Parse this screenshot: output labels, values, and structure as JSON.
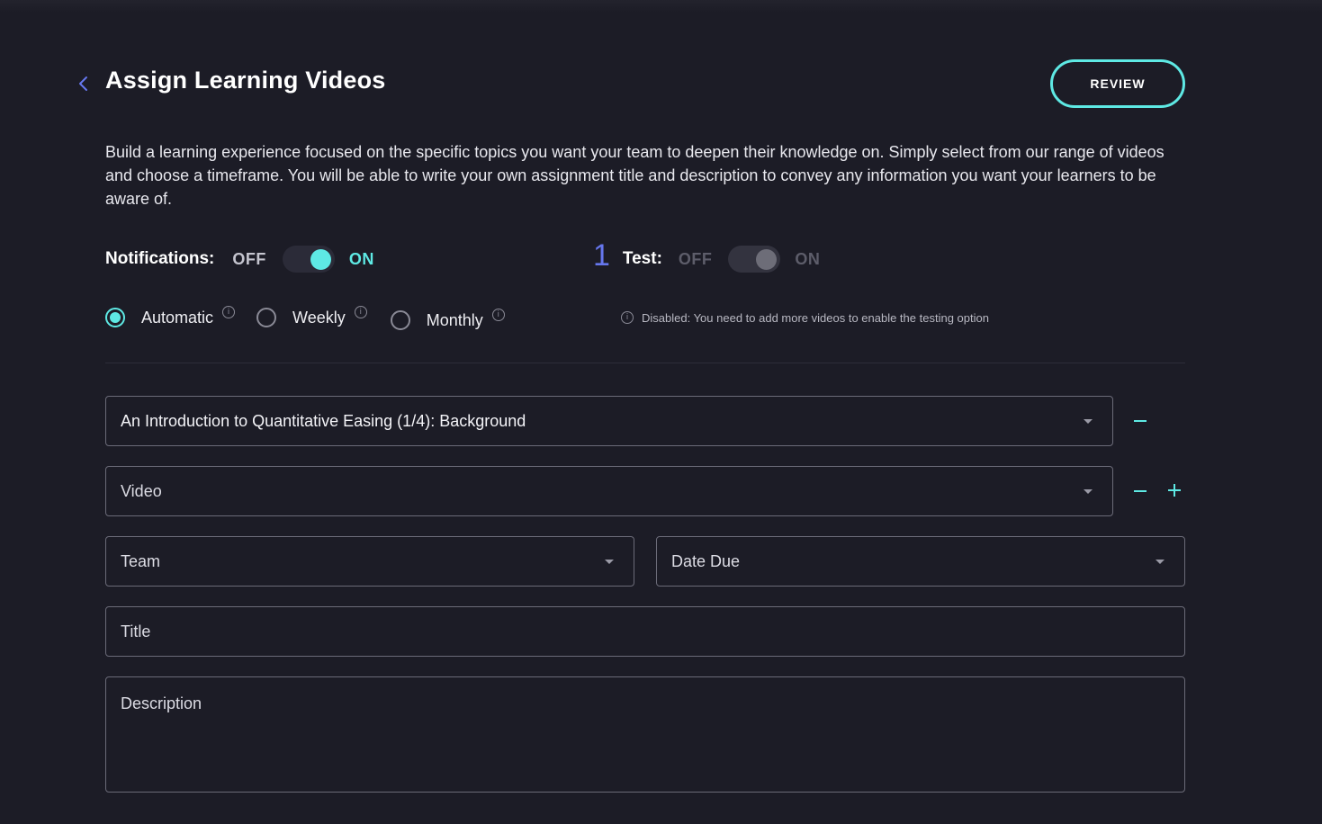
{
  "header": {
    "title": "Assign Learning Videos",
    "review_label": "REVIEW"
  },
  "intro": {
    "text": "Build a learning experience focused on the specific topics you want your team to deepen their knowledge on. Simply select from our range of videos and choose a timeframe. You will be able to write your own assignment title and description to convey any information you want your learners to be aware of."
  },
  "notifications": {
    "label": "Notifications:",
    "off_label": "OFF",
    "on_label": "ON",
    "state": "on"
  },
  "test": {
    "count": "1",
    "label": "Test:",
    "off_label": "OFF",
    "on_label": "ON",
    "state": "off",
    "disabled_note": "Disabled: You need to add more videos to enable the testing option"
  },
  "frequency": {
    "options": [
      {
        "label": "Automatic",
        "selected": true
      },
      {
        "label": "Weekly",
        "selected": false
      },
      {
        "label": "Monthly",
        "selected": false
      }
    ],
    "info_glyph": "i"
  },
  "form": {
    "video_1_value": "An Introduction to Quantitative Easing (1/4): Background",
    "video_2_placeholder": "Video",
    "team_placeholder": "Team",
    "date_placeholder": "Date Due",
    "title_placeholder": "Title",
    "description_placeholder": "Description"
  },
  "colors": {
    "background": "#1c1c26",
    "accent": "#5ee9e4",
    "count_blue": "#6677ee",
    "border": "#6b6b78"
  },
  "icons": {
    "back": "chevron-left-icon",
    "remove": "minus-icon",
    "add": "plus-icon",
    "info": "info-icon",
    "dropdown": "caret-down-icon"
  }
}
